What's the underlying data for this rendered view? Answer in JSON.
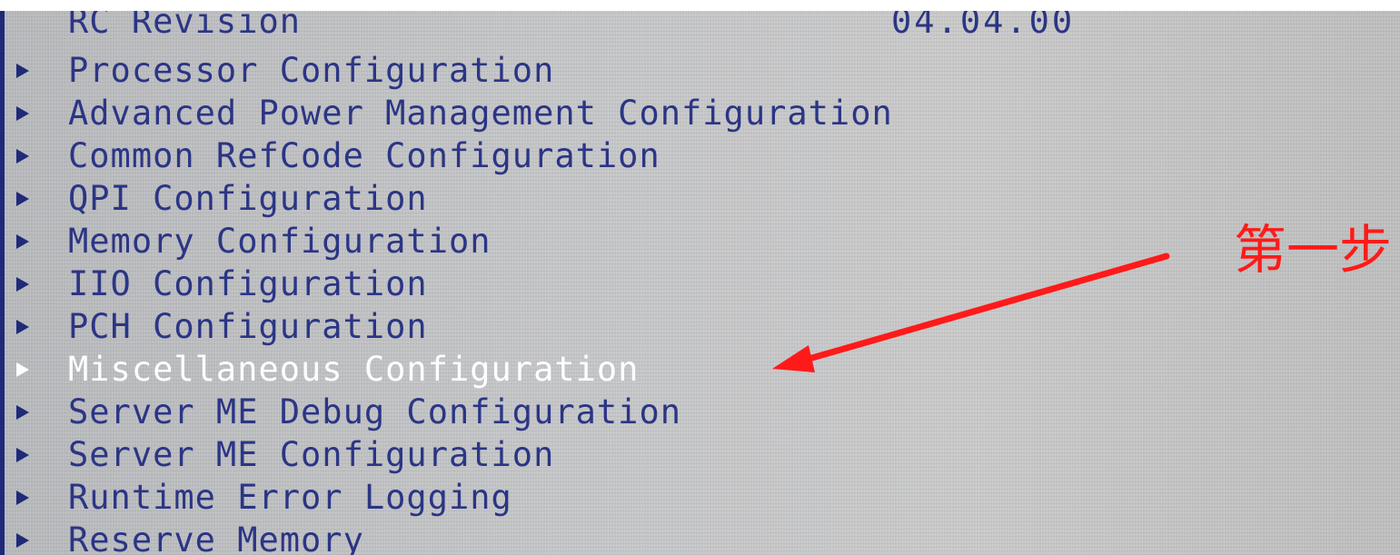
{
  "rc_revision": {
    "label": "RC Revision",
    "value": "04.04.00"
  },
  "menu": {
    "items": [
      {
        "label": "Processor Configuration"
      },
      {
        "label": "Advanced Power Management Configuration"
      },
      {
        "label": "Common RefCode Configuration"
      },
      {
        "label": "QPI Configuration"
      },
      {
        "label": "Memory Configuration"
      },
      {
        "label": "IIO Configuration"
      },
      {
        "label": "PCH Configuration"
      },
      {
        "label": "Miscellaneous Configuration",
        "selected": true
      },
      {
        "label": "Server ME Debug Configuration"
      },
      {
        "label": "Server ME Configuration"
      },
      {
        "label": "Runtime Error Logging"
      },
      {
        "label": "Reserve Memory"
      }
    ]
  },
  "annotation": {
    "text": "第一步",
    "color": "#ff1a1a"
  },
  "colors": {
    "text": "#2b3585",
    "selected_text": "#ffffff",
    "background": "#c4c5c7"
  }
}
